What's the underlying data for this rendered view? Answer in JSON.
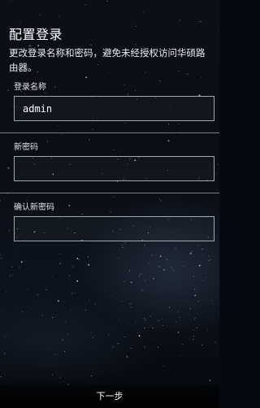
{
  "header": {
    "title": "配置登录",
    "description": "更改登录名称和密码，避免未经授权访问华硕路由器。"
  },
  "form": {
    "login_name": {
      "label": "登录名称",
      "value": "admin"
    },
    "new_password": {
      "label": "新密码",
      "value": ""
    },
    "confirm_password": {
      "label": "确认新密码",
      "value": ""
    }
  },
  "footer": {
    "next_label": "下一步"
  },
  "colors": {
    "background": "#0a0e16",
    "text": "#ffffff",
    "input_border": "#d2d8e0"
  }
}
